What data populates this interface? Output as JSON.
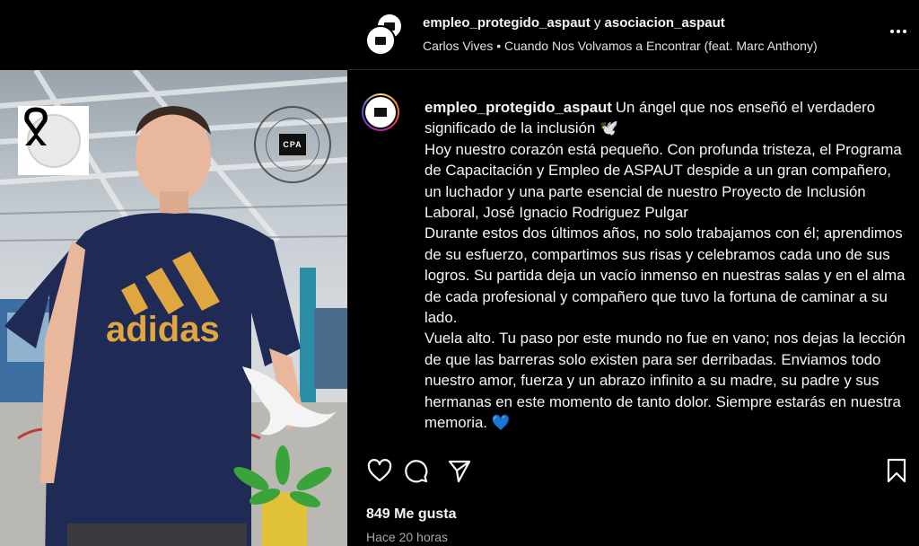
{
  "post": {
    "header": {
      "account_primary": "empleo_protegido_aspaut",
      "joiner": "y",
      "account_secondary": "asociacion_aspaut",
      "music": "Carlos Vives • Cuando Nos Volvamos a Encontrar (feat. Marc Anthony)"
    },
    "caption": {
      "username": "empleo_protegido_aspaut",
      "lines": [
        "Un ángel que nos enseñó el verdadero significado de la inclusión 🕊️",
        "Hoy nuestro corazón está pequeño. Con profunda tristeza, el Programa de Capacitación y Empleo de ASPAUT despide a un gran compañero, un luchador y una parte esencial de nuestro Proyecto de Inclusión Laboral, José Ignacio Rodriguez Pulgar",
        "Durante estos dos últimos años, no solo trabajamos con él; aprendimos de su esfuerzo, compartimos sus risas y celebramos cada uno de sus logros. Su partida deja un vacío inmenso en nuestras salas y en el alma de cada profesional y compañero que tuvo la fortuna de caminar a su lado.",
        "Vuela alto. Tu paso por este mundo no fue en vano; nos dejas la lección de que las barreras solo existen para ser derribadas. Enviamos todo nuestro amor, fuerza y un abrazo infinito a su madre, su padre y sus hermanas en este momento de tanto dolor. Siempre estarás en nuestra memoria. 💙"
      ]
    },
    "likes": "849 Me gusta",
    "timestamp": "Hace 20 horas"
  },
  "image": {
    "shirt_text": "adidas",
    "stamp_logo": "CPA"
  },
  "icons": {
    "more": "more-options-icon",
    "like": "heart-icon",
    "comment": "comment-icon",
    "share": "share-icon",
    "save": "bookmark-icon"
  },
  "colors": {
    "background": "#000000",
    "text": "#f5f5f5",
    "muted": "#a8a8a8",
    "shirt": "#1f2a55",
    "logo_gold": "#e0a640"
  }
}
